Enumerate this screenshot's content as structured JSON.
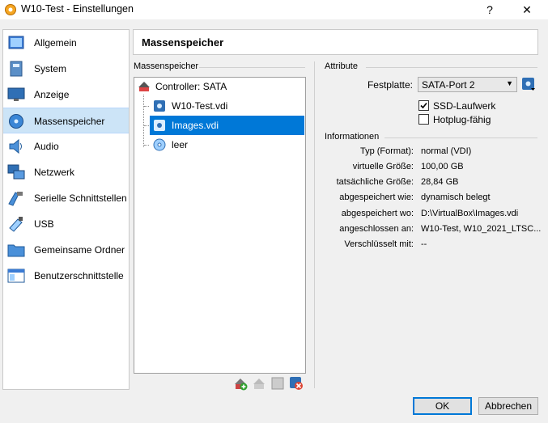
{
  "window": {
    "title": "W10-Test - Einstellungen",
    "help": "?",
    "close": "✕"
  },
  "sidebar": {
    "items": [
      {
        "label": "Allgemein",
        "icon": "general-icon"
      },
      {
        "label": "System",
        "icon": "system-icon"
      },
      {
        "label": "Anzeige",
        "icon": "display-icon"
      },
      {
        "label": "Massenspeicher",
        "icon": "storage-icon",
        "selected": true
      },
      {
        "label": "Audio",
        "icon": "audio-icon"
      },
      {
        "label": "Netzwerk",
        "icon": "network-icon"
      },
      {
        "label": "Serielle Schnittstellen",
        "icon": "serial-icon"
      },
      {
        "label": "USB",
        "icon": "usb-icon"
      },
      {
        "label": "Gemeinsame Ordner",
        "icon": "folder-icon"
      },
      {
        "label": "Benutzerschnittstelle",
        "icon": "ui-icon"
      }
    ]
  },
  "header": {
    "title": "Massenspeicher"
  },
  "storage": {
    "group_label": "Massenspeicher",
    "controller": "Controller: SATA",
    "attachments": [
      {
        "label": "W10-Test.vdi",
        "icon": "hard-disk-icon"
      },
      {
        "label": "Images.vdi",
        "icon": "hard-disk-icon",
        "selected": true
      },
      {
        "label": "leer",
        "icon": "optical-disk-icon"
      }
    ]
  },
  "attributes": {
    "group_label": "Attribute",
    "hard_disk_label": "Festplatte:",
    "hard_disk_value": "SATA-Port 2",
    "ssd_label": "SSD-Laufwerk",
    "ssd_checked": true,
    "hotplug_label": "Hotplug-fähig",
    "hotplug_checked": false
  },
  "information": {
    "group_label": "Informationen",
    "rows": [
      {
        "label": "Typ (Format):",
        "value": "normal (VDI)"
      },
      {
        "label": "virtuelle Größe:",
        "value": "100,00 GB"
      },
      {
        "label": "tatsächliche Größe:",
        "value": "28,84 GB"
      },
      {
        "label": "abgespeichert wie:",
        "value": "dynamisch belegt"
      },
      {
        "label": "abgespeichert wo:",
        "value": "D:\\VirtualBox\\Images.vdi"
      },
      {
        "label": "angeschlossen an:",
        "value": "W10-Test, W10_2021_LTSC..."
      },
      {
        "label": "Verschlüsselt mit:",
        "value": "--"
      }
    ]
  },
  "buttons": {
    "ok": "OK",
    "cancel": "Abbrechen"
  },
  "colors": {
    "selection": "#0078d7",
    "sidebar_selection": "#cce4f7"
  }
}
